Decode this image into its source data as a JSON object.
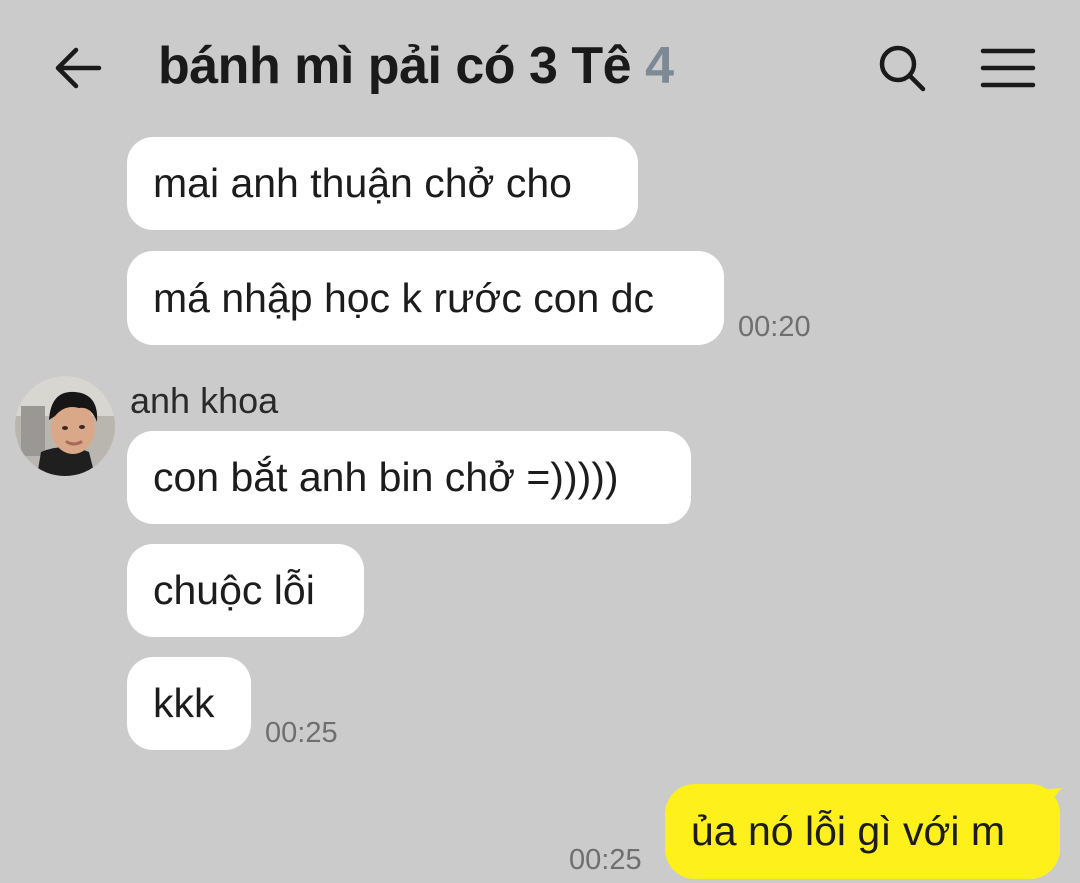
{
  "header": {
    "title": "bánh mì pải có 3 Tê",
    "member_count": "4",
    "back_icon": "arrow-left-icon",
    "search_icon": "search-icon",
    "menu_icon": "hamburger-menu-icon"
  },
  "messages": [
    {
      "text": "mai anh thuận chở cho"
    },
    {
      "text": "má nhập học k rước con dc",
      "time": "00:20"
    },
    {
      "sender": "anh khoa",
      "text": "con bắt anh bin chở =)))))"
    },
    {
      "text": "chuộc lỗi"
    },
    {
      "text": "kkk",
      "time": "00:25"
    },
    {
      "text": "ủa nó lỗi gì với m",
      "time": "00:25"
    }
  ],
  "colors": {
    "background": "#cbcbcb",
    "incoming_bubble": "#ffffff",
    "outgoing_bubble": "#fef01b",
    "member_count": "#7d8a96"
  }
}
